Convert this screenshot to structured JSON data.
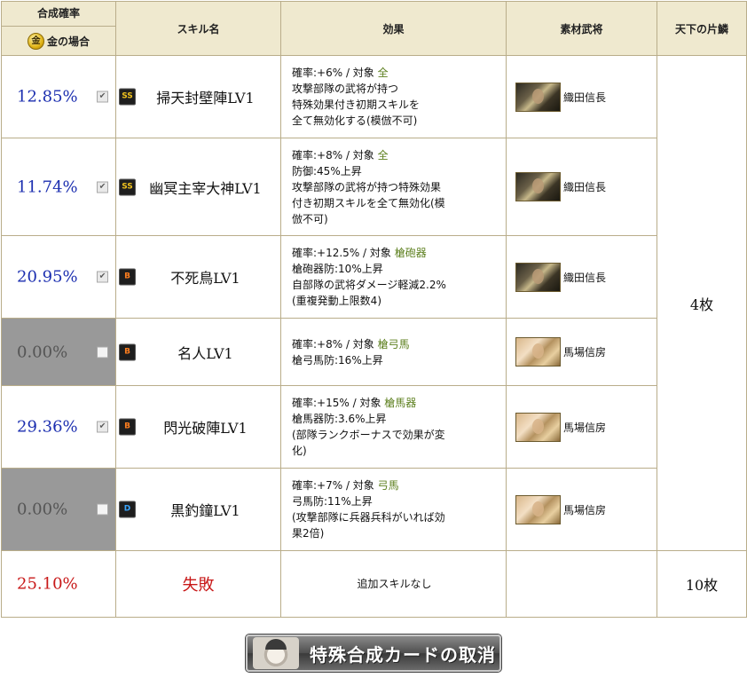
{
  "headers": {
    "rate_top": "合成確率",
    "rate_bottom": "金の場合",
    "gold_icon": "金",
    "skill": "スキル名",
    "effect": "効果",
    "general": "素材武将",
    "shards": "天下の片鱗"
  },
  "rows": [
    {
      "rate": "12.85%",
      "checked": true,
      "enabled": true,
      "rank": "SS",
      "skill": "掃天封壁陣LV1",
      "effect": [
        "確率:+6% / 対象 ",
        "全",
        "攻撃部隊の武将が持つ",
        "特殊効果付き初期スキルを",
        "全て無効化する(模倣不可)"
      ],
      "general": "織田信長"
    },
    {
      "rate": "11.74%",
      "checked": true,
      "enabled": true,
      "rank": "SS",
      "skill": "幽冥主宰大神LV1",
      "effect": [
        "確率:+8% / 対象 ",
        "全",
        "防御:45%上昇",
        "攻撃部隊の武将が持つ特殊効果",
        "付き初期スキルを全て無効化(模",
        "倣不可)"
      ],
      "general": "織田信長"
    },
    {
      "rate": "20.95%",
      "checked": true,
      "enabled": true,
      "rank": "B",
      "skill": "不死鳥LV1",
      "effect": [
        "確率:+12.5% / 対象 ",
        "槍砲器",
        "槍砲器防:10%上昇",
        "自部隊の武将ダメージ軽減2.2%",
        "(重複発動上限数4)"
      ],
      "general": "織田信長"
    },
    {
      "rate": "0.00%",
      "checked": false,
      "enabled": false,
      "rank": "B",
      "skill": "名人LV1",
      "effect": [
        "確率:+8% / 対象 ",
        "槍弓馬",
        "槍弓馬防:16%上昇"
      ],
      "general": "馬場信房"
    },
    {
      "rate": "29.36%",
      "checked": true,
      "enabled": true,
      "rank": "B",
      "skill": "閃光破陣LV1",
      "effect": [
        "確率:+15% / 対象 ",
        "槍馬器",
        "槍馬器防:3.6%上昇",
        "(部隊ランクボーナスで効果が変",
        "化)"
      ],
      "general": "馬場信房"
    },
    {
      "rate": "0.00%",
      "checked": false,
      "enabled": false,
      "rank": "D",
      "skill": "黒釣鐘LV1",
      "effect": [
        "確率:+7% / 対象 ",
        "弓馬",
        "弓馬防:11%上昇",
        "(攻撃部隊に兵器兵科がいれば効",
        "果2倍)"
      ],
      "general": "馬場信房"
    }
  ],
  "shards_main": "4枚",
  "fail_row": {
    "rate": "25.10%",
    "label": "失敗",
    "effect": "追加スキルなし",
    "shards": "10枚"
  },
  "cancel_button": "特殊合成カードの取消"
}
